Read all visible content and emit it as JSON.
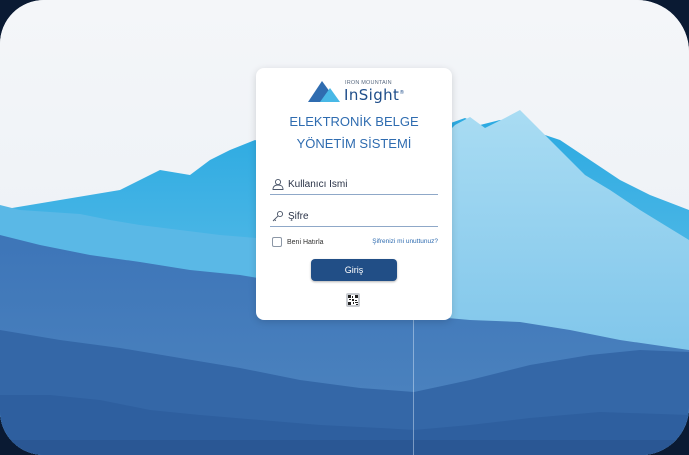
{
  "logo": {
    "company": "IRON MOUNTAIN",
    "product": "InSight",
    "registered": "®"
  },
  "title": {
    "line1": "ELEKTRONİK BELGE",
    "line2": "YÖNETİM SİSTEMİ"
  },
  "form": {
    "username_placeholder": "Kullanıcı İsmi",
    "password_placeholder": "Şifre",
    "remember_label": "Beni Hatırla",
    "forgot_label": "Şifrenizi mi unuttunuz?",
    "submit_label": "Giriş"
  },
  "icons": {
    "username": "user-icon",
    "password": "key-icon",
    "qr": "qr-code-icon",
    "logo": "mountain-logo-icon"
  },
  "colors": {
    "accent": "#214e86",
    "title": "#2f6cb0",
    "sky_light": "#48b8e6",
    "mountain_dark": "#2d63a4"
  }
}
